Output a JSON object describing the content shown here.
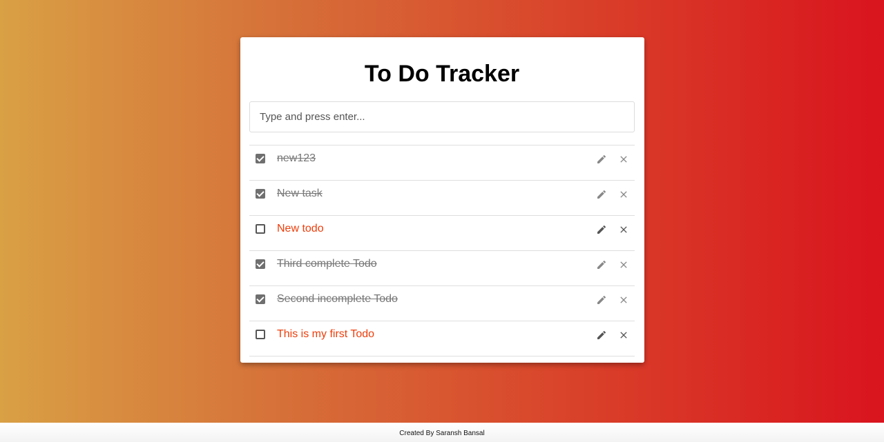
{
  "app": {
    "title": "To Do Tracker"
  },
  "input": {
    "placeholder": "Type and press enter...",
    "value": ""
  },
  "todos": [
    {
      "text": "new123",
      "completed": true
    },
    {
      "text": "New task",
      "completed": true
    },
    {
      "text": "New todo",
      "completed": false
    },
    {
      "text": "Third complete Todo",
      "completed": true
    },
    {
      "text": "Second incomplete Todo",
      "completed": true
    },
    {
      "text": "This is my first Todo",
      "completed": false
    }
  ],
  "icons": {
    "edit": "pencil-icon",
    "delete": "close-icon",
    "checkbox_checked": "checkbox-checked-icon",
    "checkbox_unchecked": "checkbox-unchecked-icon"
  },
  "colors": {
    "gradient_start": "#d9a044",
    "gradient_end": "#d9141e",
    "incomplete_text": "#ee3d0a",
    "complete_text": "#777777",
    "icon_active": "#555555",
    "icon_muted": "#888888"
  },
  "footer": {
    "text": "Created By Saransh Bansal"
  }
}
